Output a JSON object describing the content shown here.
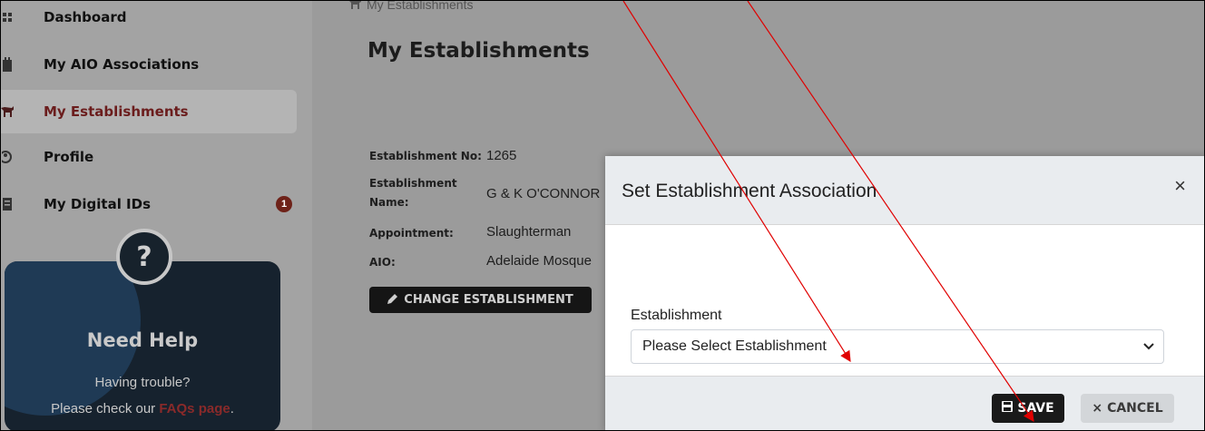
{
  "sidebar": {
    "items": [
      {
        "label": "Dashboard",
        "icon": "grid-icon"
      },
      {
        "label": "My AIO Associations",
        "icon": "building-icon"
      },
      {
        "label": "My Establishments",
        "icon": "cow-icon",
        "active": true
      },
      {
        "label": "Profile",
        "icon": "user-circle-icon"
      },
      {
        "label": "My Digital IDs",
        "icon": "id-card-icon",
        "badge": "1"
      }
    ],
    "help": {
      "icon": "?",
      "title": "Need Help",
      "line1": "Having trouble?",
      "line2_prefix": "Please check our ",
      "link": "FAQs page",
      "line2_suffix": "."
    }
  },
  "breadcrumb": "My Establishments",
  "page_title": "My Establishments",
  "establishment": {
    "no_label": "Establishment No:",
    "no_value": "1265",
    "name_label_1": "Establishment",
    "name_label_2": "Name:",
    "name_value": "G & K O'CONNOR",
    "appointment_label": "Appointment:",
    "appointment_value": "Slaughterman",
    "aio_label": "AIO:",
    "aio_value": "Adelaide Mosque"
  },
  "change_button": "CHANGE ESTABLISHMENT",
  "modal": {
    "title": "Set Establishment Association",
    "close": "×",
    "field_label": "Establishment",
    "select_value": "Please Select Establishment",
    "save": "SAVE",
    "cancel": "CANCEL",
    "cancel_icon": "×"
  },
  "colors": {
    "overlay": "#9b9b9b",
    "accent_dark_red": "#6b1d1d",
    "annotation_arrow": "#e00000"
  }
}
